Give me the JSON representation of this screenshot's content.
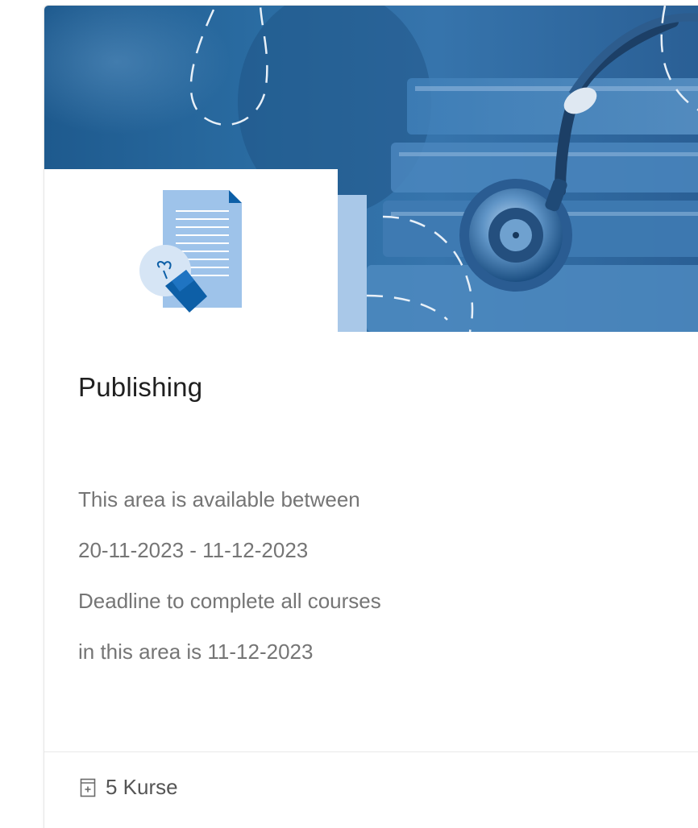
{
  "card": {
    "title": "Publishing",
    "description_lines": [
      "This area is available between",
      "20-11-2023 - 11-12-2023",
      "Deadline to complete all courses",
      "in this area is 11-12-2023"
    ],
    "course_count_label": "5 Kurse"
  },
  "icons": {
    "banner_image": "stethoscope-books-image",
    "area_icon": "document-lightbulb-icon",
    "footer_icon": "course-list-icon"
  },
  "colors": {
    "banner_blue": "#2b6da3",
    "accent_light_blue": "#a9c8e8",
    "icon_blue": "#0d5fa7",
    "text_dark": "#1f1f1f",
    "text_muted": "#757575"
  }
}
